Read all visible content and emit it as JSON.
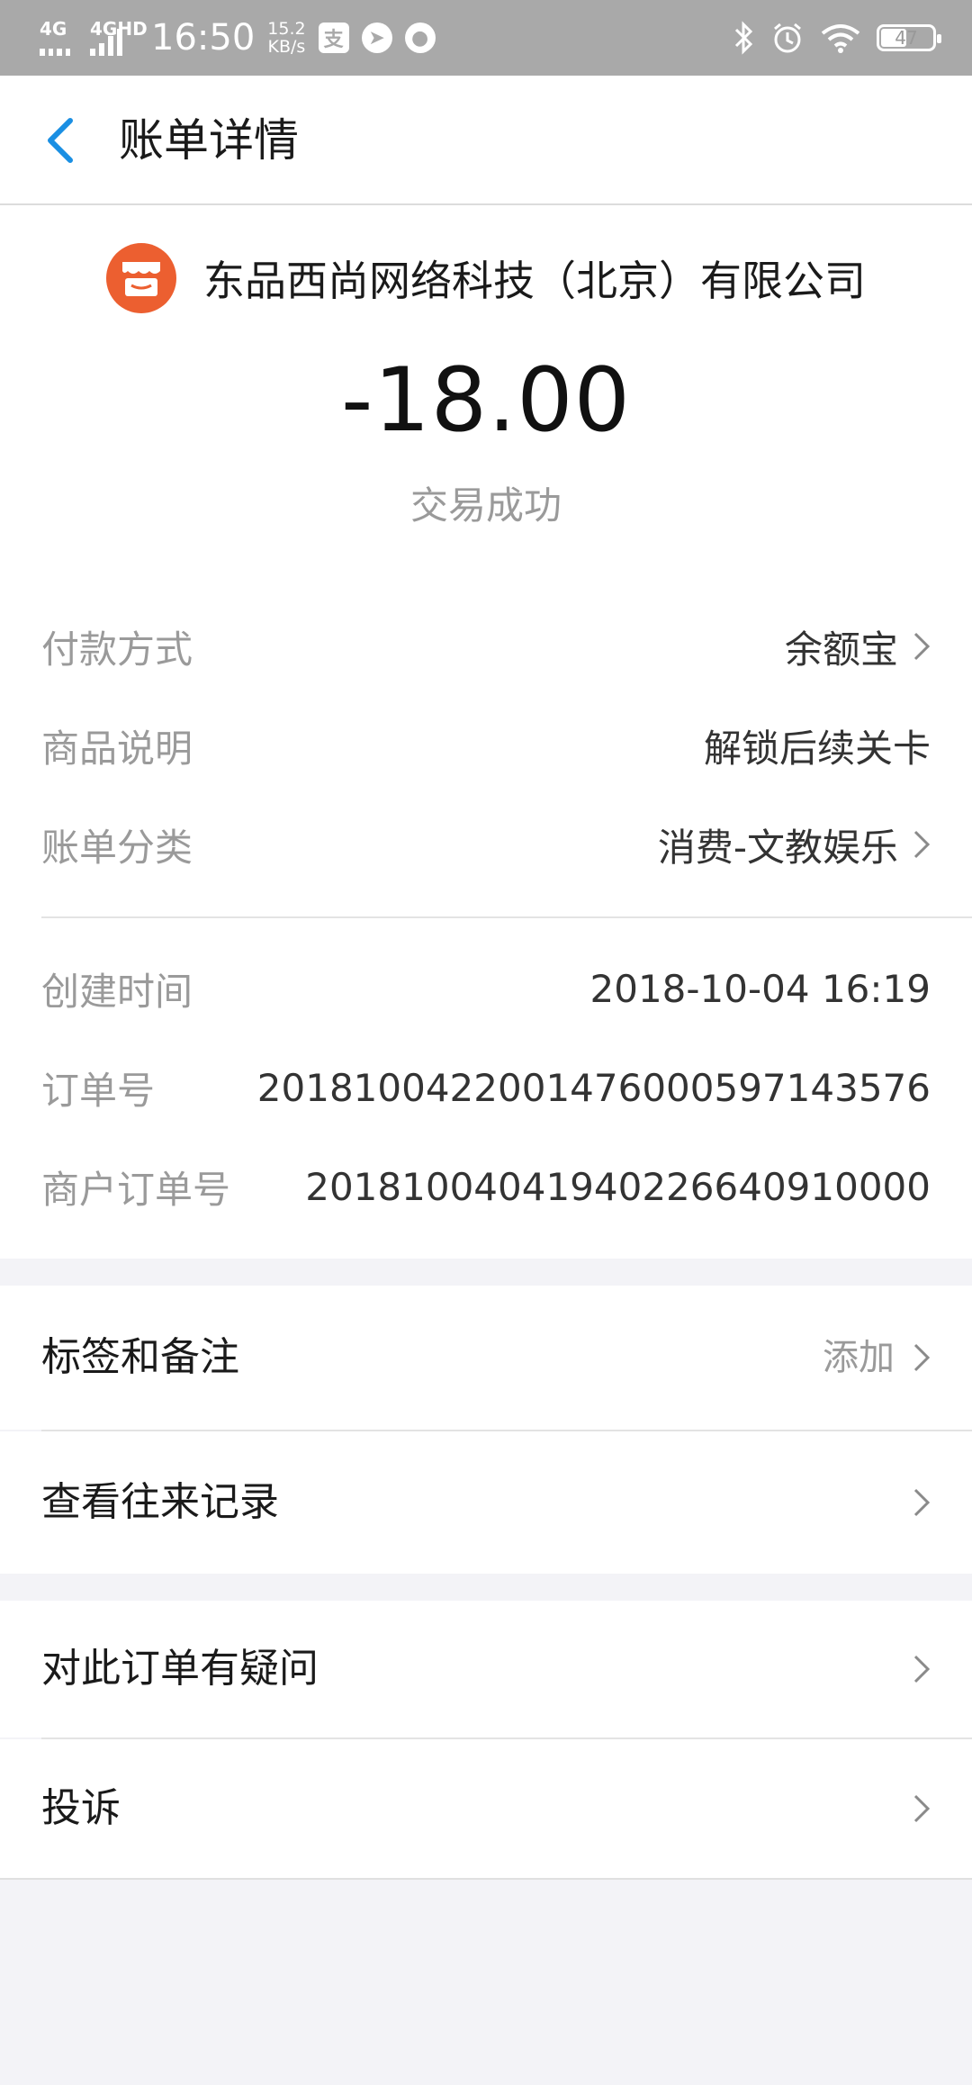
{
  "status_bar": {
    "net1": "4G",
    "net2": "4GHD",
    "time": "16:50",
    "speed_value": "15.2",
    "speed_unit": "KB/s",
    "battery": "47"
  },
  "nav": {
    "title": "账单详情"
  },
  "merchant": {
    "name": "东品西尚网络科技（北京）有限公司",
    "amount": "-18.00",
    "status": "交易成功"
  },
  "details_group1": [
    {
      "label": "付款方式",
      "value": "余额宝",
      "chevron": true
    },
    {
      "label": "商品说明",
      "value": "解锁后续关卡",
      "chevron": false
    },
    {
      "label": "账单分类",
      "value": "消费-文教娱乐",
      "chevron": true
    }
  ],
  "details_group2": [
    {
      "label": "创建时间",
      "value": "2018-10-04 16:19"
    },
    {
      "label": "订单号",
      "value": "2018100422001476000597143576"
    },
    {
      "label": "商户订单号",
      "value": "20181004041940226640910000"
    }
  ],
  "menu": {
    "tags": {
      "label": "标签和备注",
      "hint": "添加"
    },
    "history": {
      "label": "查看往来记录"
    },
    "question": {
      "label": "对此订单有疑问"
    },
    "complain": {
      "label": "投诉"
    }
  },
  "colors": {
    "accent": "#1a8fe3",
    "merchant_logo": "#ec5f30",
    "status_bar": "#a9a9a9"
  }
}
